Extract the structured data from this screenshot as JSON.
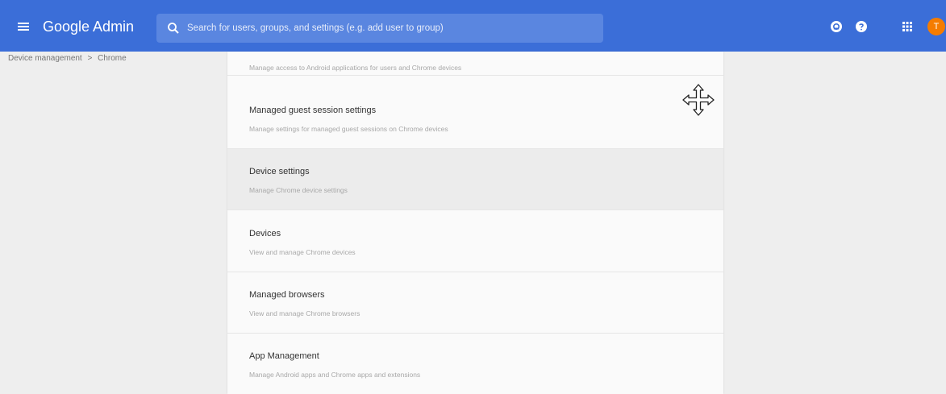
{
  "header": {
    "app_title": "Google Admin",
    "search_placeholder": "Search for users, groups, and settings (e.g. add user to group)",
    "avatar_initial": "T",
    "icons": [
      "menu-icon",
      "search-icon",
      "support-icon",
      "help-icon",
      "apps-grid-icon"
    ]
  },
  "breadcrumb": {
    "items": [
      "Device management",
      "Chrome"
    ],
    "separator": ">"
  },
  "settings_list": {
    "items": [
      {
        "title": "",
        "description": "Manage access to Android applications for users and Chrome devices"
      },
      {
        "title": "Managed guest session settings",
        "description": "Manage settings for managed guest sessions on Chrome devices"
      },
      {
        "title": "Device settings",
        "description": "Manage Chrome device settings"
      },
      {
        "title": "Devices",
        "description": "View and manage Chrome devices"
      },
      {
        "title": "Managed browsers",
        "description": "View and manage Chrome browsers"
      },
      {
        "title": "App Management",
        "description": "Manage Android apps and Chrome apps and extensions"
      }
    ],
    "selected_index": 2
  },
  "colors": {
    "topbar": "#3b6ed8",
    "search_box": "#5a86e0",
    "avatar": "#f57c00",
    "page_background": "#eeeeee",
    "panel_background": "#fafafa",
    "selected_row": "#ececec"
  }
}
